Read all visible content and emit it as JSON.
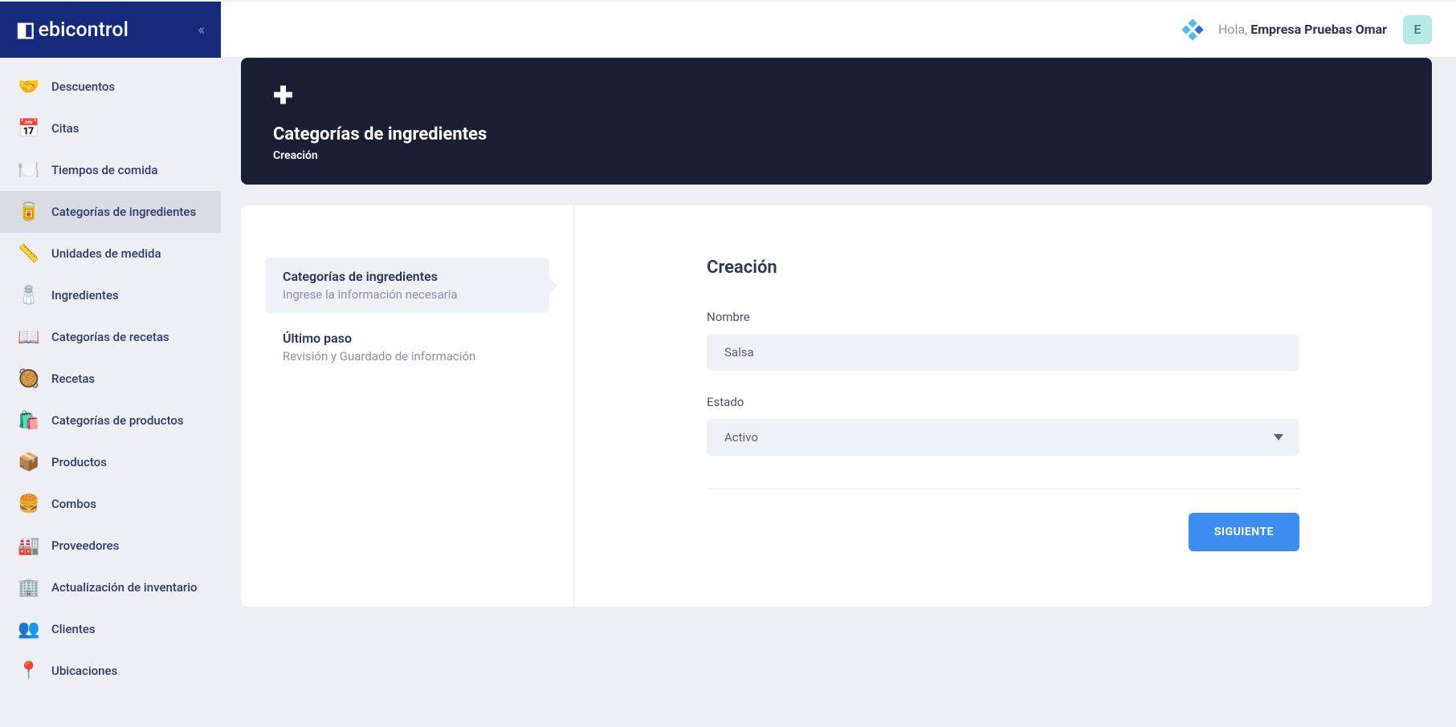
{
  "brand": "ebicontrol",
  "sidebar": {
    "items": [
      {
        "label": "Descuentos",
        "icon": "🤝"
      },
      {
        "label": "Citas",
        "icon": "📅"
      },
      {
        "label": "Tiempos de comida",
        "icon": "🍽️"
      },
      {
        "label": "Categorías de ingredientes",
        "icon": "🥫"
      },
      {
        "label": "Unidades de medida",
        "icon": "📏"
      },
      {
        "label": "Ingredientes",
        "icon": "🧂"
      },
      {
        "label": "Categorías de recetas",
        "icon": "📖"
      },
      {
        "label": "Recetas",
        "icon": "🥘"
      },
      {
        "label": "Categorías de productos",
        "icon": "🛍️"
      },
      {
        "label": "Productos",
        "icon": "📦"
      },
      {
        "label": "Combos",
        "icon": "🍔"
      },
      {
        "label": "Proveedores",
        "icon": "🏭"
      },
      {
        "label": "Actualización de inventario",
        "icon": "🏢"
      },
      {
        "label": "Clientes",
        "icon": "👥"
      },
      {
        "label": "Ubicaciones",
        "icon": "📍"
      }
    ]
  },
  "topbar": {
    "greeting_prefix": "Hola, ",
    "user_name": "Empresa Pruebas Omar",
    "avatar_letter": "E"
  },
  "header": {
    "title": "Categorías de ingredientes",
    "subtitle": "Creación"
  },
  "steps": [
    {
      "title": "Categorías de ingredientes",
      "desc": "Ingrese la información necesaria"
    },
    {
      "title": "Último paso",
      "desc": "Revisión y Guardado de información"
    }
  ],
  "form": {
    "title": "Creación",
    "name_label": "Nombre",
    "name_value": "Salsa",
    "status_label": "Estado",
    "status_value": "Activo",
    "submit_label": "SIGUIENTE"
  }
}
